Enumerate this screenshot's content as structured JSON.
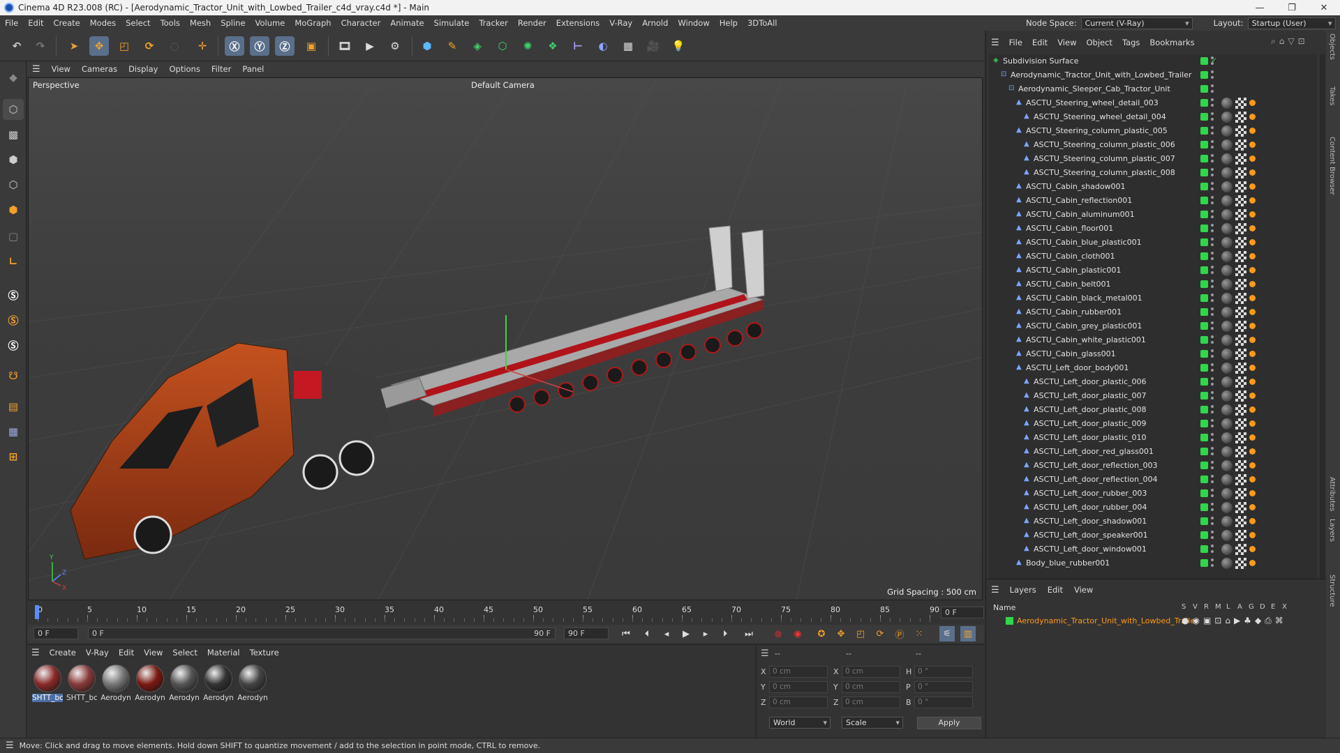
{
  "window": {
    "title": "Cinema 4D R23.008 (RC) - [Aerodynamic_Tractor_Unit_with_Lowbed_Trailer_c4d_vray.c4d *] - Main"
  },
  "menu": [
    "File",
    "Edit",
    "Create",
    "Modes",
    "Select",
    "Tools",
    "Mesh",
    "Spline",
    "Volume",
    "MoGraph",
    "Character",
    "Animate",
    "Simulate",
    "Tracker",
    "Render",
    "Extensions",
    "V-Ray",
    "Arnold",
    "Window",
    "Help",
    "3DToAll"
  ],
  "node_space": {
    "label": "Node Space:",
    "value": "Current (V-Ray)"
  },
  "layout": {
    "label": "Layout:",
    "value": "Startup (User)"
  },
  "viewport": {
    "menu": [
      "View",
      "Cameras",
      "Display",
      "Options",
      "Filter",
      "Panel"
    ],
    "view_label": "Perspective",
    "camera_label": "Default Camera",
    "grid_spacing": "Grid Spacing : 500 cm"
  },
  "timeline": {
    "ticks": [
      "0",
      "5",
      "10",
      "15",
      "20",
      "25",
      "30",
      "35",
      "40",
      "45",
      "50",
      "55",
      "60",
      "65",
      "70",
      "75",
      "80",
      "85",
      "90"
    ],
    "current_frame": "0 F",
    "start_field": "0 F",
    "range_start": "0 F",
    "range_end": "90 F",
    "end_field": "90 F"
  },
  "materials": {
    "menu": [
      "Create",
      "V-Ray",
      "Edit",
      "View",
      "Select",
      "Material",
      "Texture"
    ],
    "items": [
      {
        "name": "SHTT_bc",
        "color": "#8a2a2a"
      },
      {
        "name": "SHTT_bc",
        "color": "#8a3a3a"
      },
      {
        "name": "Aerodyn",
        "color": "#777777"
      },
      {
        "name": "Aerodyn",
        "color": "#7a1a12"
      },
      {
        "name": "Aerodyn",
        "color": "#555555"
      },
      {
        "name": "Aerodyn",
        "color": "#333333"
      },
      {
        "name": "Aerodyn",
        "color": "#444444"
      }
    ]
  },
  "coords": {
    "header": [
      "--",
      "--",
      "--"
    ],
    "rows": [
      {
        "a": "X",
        "av": "0 cm",
        "b": "X",
        "bv": "0 cm",
        "c": "H",
        "cv": "0 °"
      },
      {
        "a": "Y",
        "av": "0 cm",
        "b": "Y",
        "bv": "0 cm",
        "c": "P",
        "cv": "0 °"
      },
      {
        "a": "Z",
        "av": "0 cm",
        "b": "Z",
        "bv": "0 cm",
        "c": "B",
        "cv": "0 °"
      }
    ],
    "mode": "World",
    "scale": "Scale",
    "apply": "Apply"
  },
  "status": "Move: Click and drag to move elements. Hold down SHIFT to quantize movement / add to the selection in point mode, CTRL to remove.",
  "objects": {
    "menu": [
      "File",
      "Edit",
      "View",
      "Object",
      "Tags",
      "Bookmarks"
    ],
    "rows": [
      {
        "name": "Subdivision Surface",
        "indent": 0
      },
      {
        "name": "Aerodynamic_Tractor_Unit_with_Lowbed_Trailer",
        "indent": 1
      },
      {
        "name": "Aerodynamic_Sleeper_Cab_Tractor_Unit",
        "indent": 2
      },
      {
        "name": "ASCTU_Steering_wheel_detail_003",
        "indent": 3
      },
      {
        "name": "ASCTU_Steering_wheel_detail_004",
        "indent": 4
      },
      {
        "name": "ASCTU_Steering_column_plastic_005",
        "indent": 3
      },
      {
        "name": "ASCTU_Steering_column_plastic_006",
        "indent": 4
      },
      {
        "name": "ASCTU_Steering_column_plastic_007",
        "indent": 4
      },
      {
        "name": "ASCTU_Steering_column_plastic_008",
        "indent": 4
      },
      {
        "name": "ASCTU_Cabin_shadow001",
        "indent": 3
      },
      {
        "name": "ASCTU_Cabin_reflection001",
        "indent": 3
      },
      {
        "name": "ASCTU_Cabin_aluminum001",
        "indent": 3
      },
      {
        "name": "ASCTU_Cabin_floor001",
        "indent": 3
      },
      {
        "name": "ASCTU_Cabin_blue_plastic001",
        "indent": 3
      },
      {
        "name": "ASCTU_Cabin_cloth001",
        "indent": 3
      },
      {
        "name": "ASCTU_Cabin_plastic001",
        "indent": 3
      },
      {
        "name": "ASCTU_Cabin_belt001",
        "indent": 3
      },
      {
        "name": "ASCTU_Cabin_black_metal001",
        "indent": 3
      },
      {
        "name": "ASCTU_Cabin_rubber001",
        "indent": 3
      },
      {
        "name": "ASCTU_Cabin_grey_plastic001",
        "indent": 3
      },
      {
        "name": "ASCTU_Cabin_white_plastic001",
        "indent": 3
      },
      {
        "name": "ASCTU_Cabin_glass001",
        "indent": 3
      },
      {
        "name": "ASCTU_Left_door_body001",
        "indent": 3
      },
      {
        "name": "ASCTU_Left_door_plastic_006",
        "indent": 4
      },
      {
        "name": "ASCTU_Left_door_plastic_007",
        "indent": 4
      },
      {
        "name": "ASCTU_Left_door_plastic_008",
        "indent": 4
      },
      {
        "name": "ASCTU_Left_door_plastic_009",
        "indent": 4
      },
      {
        "name": "ASCTU_Left_door_plastic_010",
        "indent": 4
      },
      {
        "name": "ASCTU_Left_door_red_glass001",
        "indent": 4
      },
      {
        "name": "ASCTU_Left_door_reflection_003",
        "indent": 4
      },
      {
        "name": "ASCTU_Left_door_reflection_004",
        "indent": 4
      },
      {
        "name": "ASCTU_Left_door_rubber_003",
        "indent": 4
      },
      {
        "name": "ASCTU_Left_door_rubber_004",
        "indent": 4
      },
      {
        "name": "ASCTU_Left_door_shadow001",
        "indent": 4
      },
      {
        "name": "ASCTU_Left_door_speaker001",
        "indent": 4
      },
      {
        "name": "ASCTU_Left_door_window001",
        "indent": 4
      },
      {
        "name": "Body_blue_rubber001",
        "indent": 3
      }
    ]
  },
  "layers": {
    "menu": [
      "Layers",
      "Edit",
      "View"
    ],
    "name_header": "Name",
    "flags": [
      "S",
      "V",
      "R",
      "M",
      "L",
      "A",
      "G",
      "D",
      "E",
      "X"
    ],
    "item": "Aerodynamic_Tractor_Unit_with_Lowbed_Trailer"
  },
  "side_tabs": [
    "Objects",
    "Takes",
    "Content Browser",
    "Attributes",
    "Layers",
    "Structure"
  ]
}
